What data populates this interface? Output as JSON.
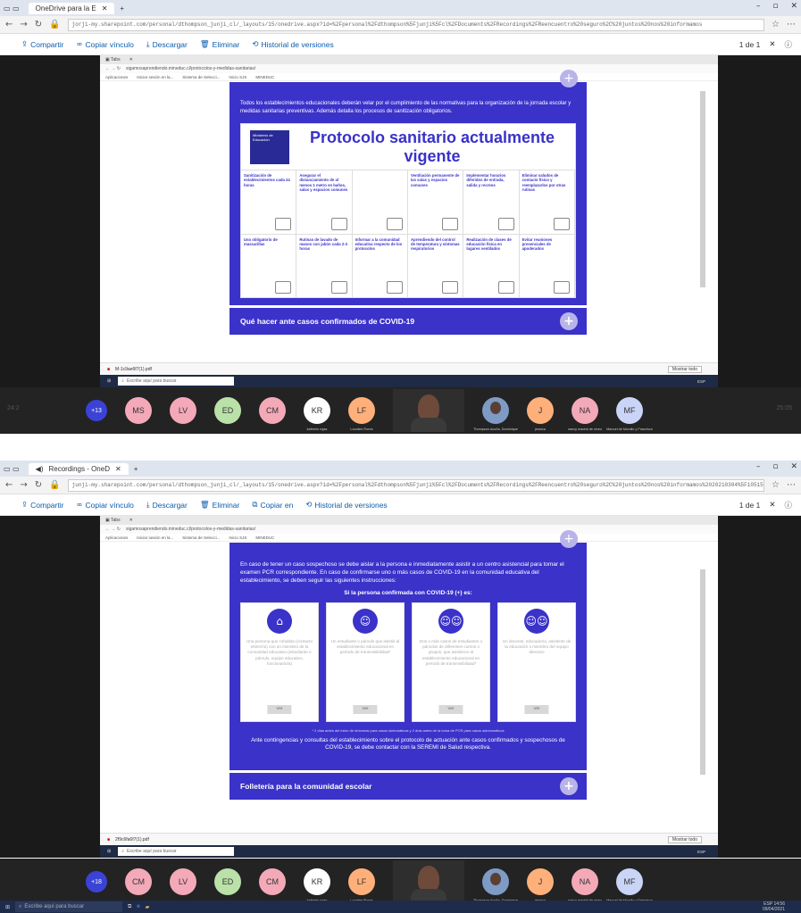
{
  "shot1": {
    "tab_title": "OneDrive para la E",
    "url": "jorji-my.sharepoint.com/personal/dthompson_junji_cl/_layouts/15/onedrive.aspx?id=%2Fpersonal%2Fdthompson%5Fjunji%5Fcl%2FDocuments%2FRecordings%2FReencuentro%20seguro%2C%20juntos%20nos%20informamos",
    "actions": {
      "share": "Compartir",
      "copy_link": "Copiar vínculo",
      "download": "Descargar",
      "delete": "Eliminar",
      "history": "Historial de versiones"
    },
    "pager": "1 de 1",
    "intro": "Todos los establecimientos educacionales deberán velar por el cumplimiento de las normativas para la organización de la jornada escolar y medidas sanitarias preventivas. Además detalla los procesos de sanitización obligatorios.",
    "protocol_title": "Protocolo sanitario actualmente vigente",
    "ministry": "Ministerio de Educación",
    "cells": [
      "Sanitización de establecimientos cada 24 horas",
      "Asegurar el distanciamiento de al menos 1 metro en baños, salas y espacios comunes",
      "",
      "Ventilación permanente de las salas y espacios comunes",
      "Implementar horarios diferidos de entrada, salida y recreos",
      "Eliminar saludos de contacto físico y reemplazarlos por otras rutinas",
      "Uso obligatorio de mascarillas",
      "Rutinas de lavado de manos con jabón cada 2-3 horas",
      "Informar a la comunidad educativa respecto de los protocolos",
      "Aprendiendo del control de temperatura y síntomas respiratorios",
      "Realización de clases de educación física en lugares ventilados",
      "Evitar reuniones presenciales de apoderados"
    ],
    "section_title": "Qué hacer ante casos confirmados de COVID-19",
    "download_file": "M-1c9ae6f7(1).pdf",
    "show_all": "Mostrar todo",
    "search_placeholder": "Escribe aquí para buscar",
    "participants": [
      {
        "initials": "+13",
        "name": ""
      },
      {
        "initials": "MS",
        "name": ""
      },
      {
        "initials": "LV",
        "name": ""
      },
      {
        "initials": "ED",
        "name": ""
      },
      {
        "initials": "CM",
        "name": ""
      },
      {
        "initials": "KR",
        "name": "katherin rojas"
      },
      {
        "initials": "LF",
        "name": "Lourdes Flores"
      },
      {
        "initials": "J",
        "name": "jessica"
      },
      {
        "initials": "NA",
        "name": "nancy madrid de niveo"
      },
      {
        "initials": "MF",
        "name": "Manuel de Morallo y Francisco"
      }
    ],
    "video_name": "Thompson Acuña, Dominique",
    "zoom_side_left": "24:2",
    "zoom_side_right": "25:05"
  },
  "shot2": {
    "tab_title": "Recordings - OneD",
    "url": "junji-my.sharepoint.com/personal/dthompson_junji_cl/_layouts/15/onedrive.aspx?id=%2Fpersonal%2Fdthompson%5Fjunji%5Fcl%2FDocuments%2FRecordings%2FReencuentro%20seguro%2C%20juntos%20nos%20informamos%2020210304%5F105159",
    "actions": {
      "share": "Compartir",
      "copy_link": "Copiar vínculo",
      "download": "Descargar",
      "delete": "Eliminar",
      "copy_in": "Copiar en",
      "history": "Historial de versiones"
    },
    "pager": "1 de 1",
    "intro": "En caso de tener un caso sospechoso se debe aislar a la persona e inmediatamente asistir a un centro asistencial para tomar el examen PCR correspondiente. En caso de confirmarse uno o más casos de COVID-19 en la comunidad educativa del establecimiento, se deben seguir las siguientes instrucciones:",
    "confirm_heading": "Si la persona confirmada con COVID-19 (+) es:",
    "cards": [
      {
        "icon": "⌂",
        "text": "Una persona que cohabita (contacto estrecho) con un miembro de la comunidad educativa (estudiante o párvulo, equipo educativo, funcionario/a)",
        "button": "Ver"
      },
      {
        "icon": "☺",
        "text": "Un estudiante o párvulo que asistió al establecimiento educacional en período de transmisibilidad*",
        "button": "Ver"
      },
      {
        "icon": "☺☺",
        "text": "Dos o más casos de estudiantes o párvulos de diferentes cursos o grupos, que asistieron al establecimiento educacional en período de transmisibilidad*",
        "button": "Ver"
      },
      {
        "icon": "☺☺",
        "text": "Un docente, educador/a, asistente de la educación o miembro del equipo directivo",
        "button": "Ver"
      }
    ],
    "footnote": "* 2 días antes del inicio de síntomas para casos sintomáticos y 2 días antes de la toma de PCR para casos asintomáticos",
    "contact_text": "Ante contingencias y consultas del establecimiento sobre el protocolo de actuación ante casos confirmados y sospechosos de COVID-19, se debe contactar con la SEREMI de Salud respectiva.",
    "section_title": "Folletería para la comunidad escolar",
    "download_file": "2f9c6fa6f7(1).pdf",
    "show_all": "Mostrar todo",
    "search_placeholder": "Escribe aquí para buscar",
    "participants": [
      {
        "initials": "+18",
        "name": ""
      },
      {
        "initials": "CM",
        "name": ""
      },
      {
        "initials": "LV",
        "name": ""
      },
      {
        "initials": "ED",
        "name": ""
      },
      {
        "initials": "CM",
        "name": ""
      },
      {
        "initials": "KR",
        "name": "katherin rojas"
      },
      {
        "initials": "LF",
        "name": "Lourdes Flores"
      },
      {
        "initials": "J",
        "name": "jessica"
      },
      {
        "initials": "NA",
        "name": "nancy madrid de niveo"
      },
      {
        "initials": "MF",
        "name": "Manuel de Morallo y Francisco"
      }
    ],
    "video_name": "Thompson Acuña, Dominique"
  },
  "taskbar": {
    "search_placeholder": "Escribe aquí para buscar",
    "time": "14:56",
    "date": "09/04/2021",
    "lang": "ESP"
  },
  "colors": {
    "accent": "#3a32c9",
    "zoom_bg": "#232323"
  }
}
